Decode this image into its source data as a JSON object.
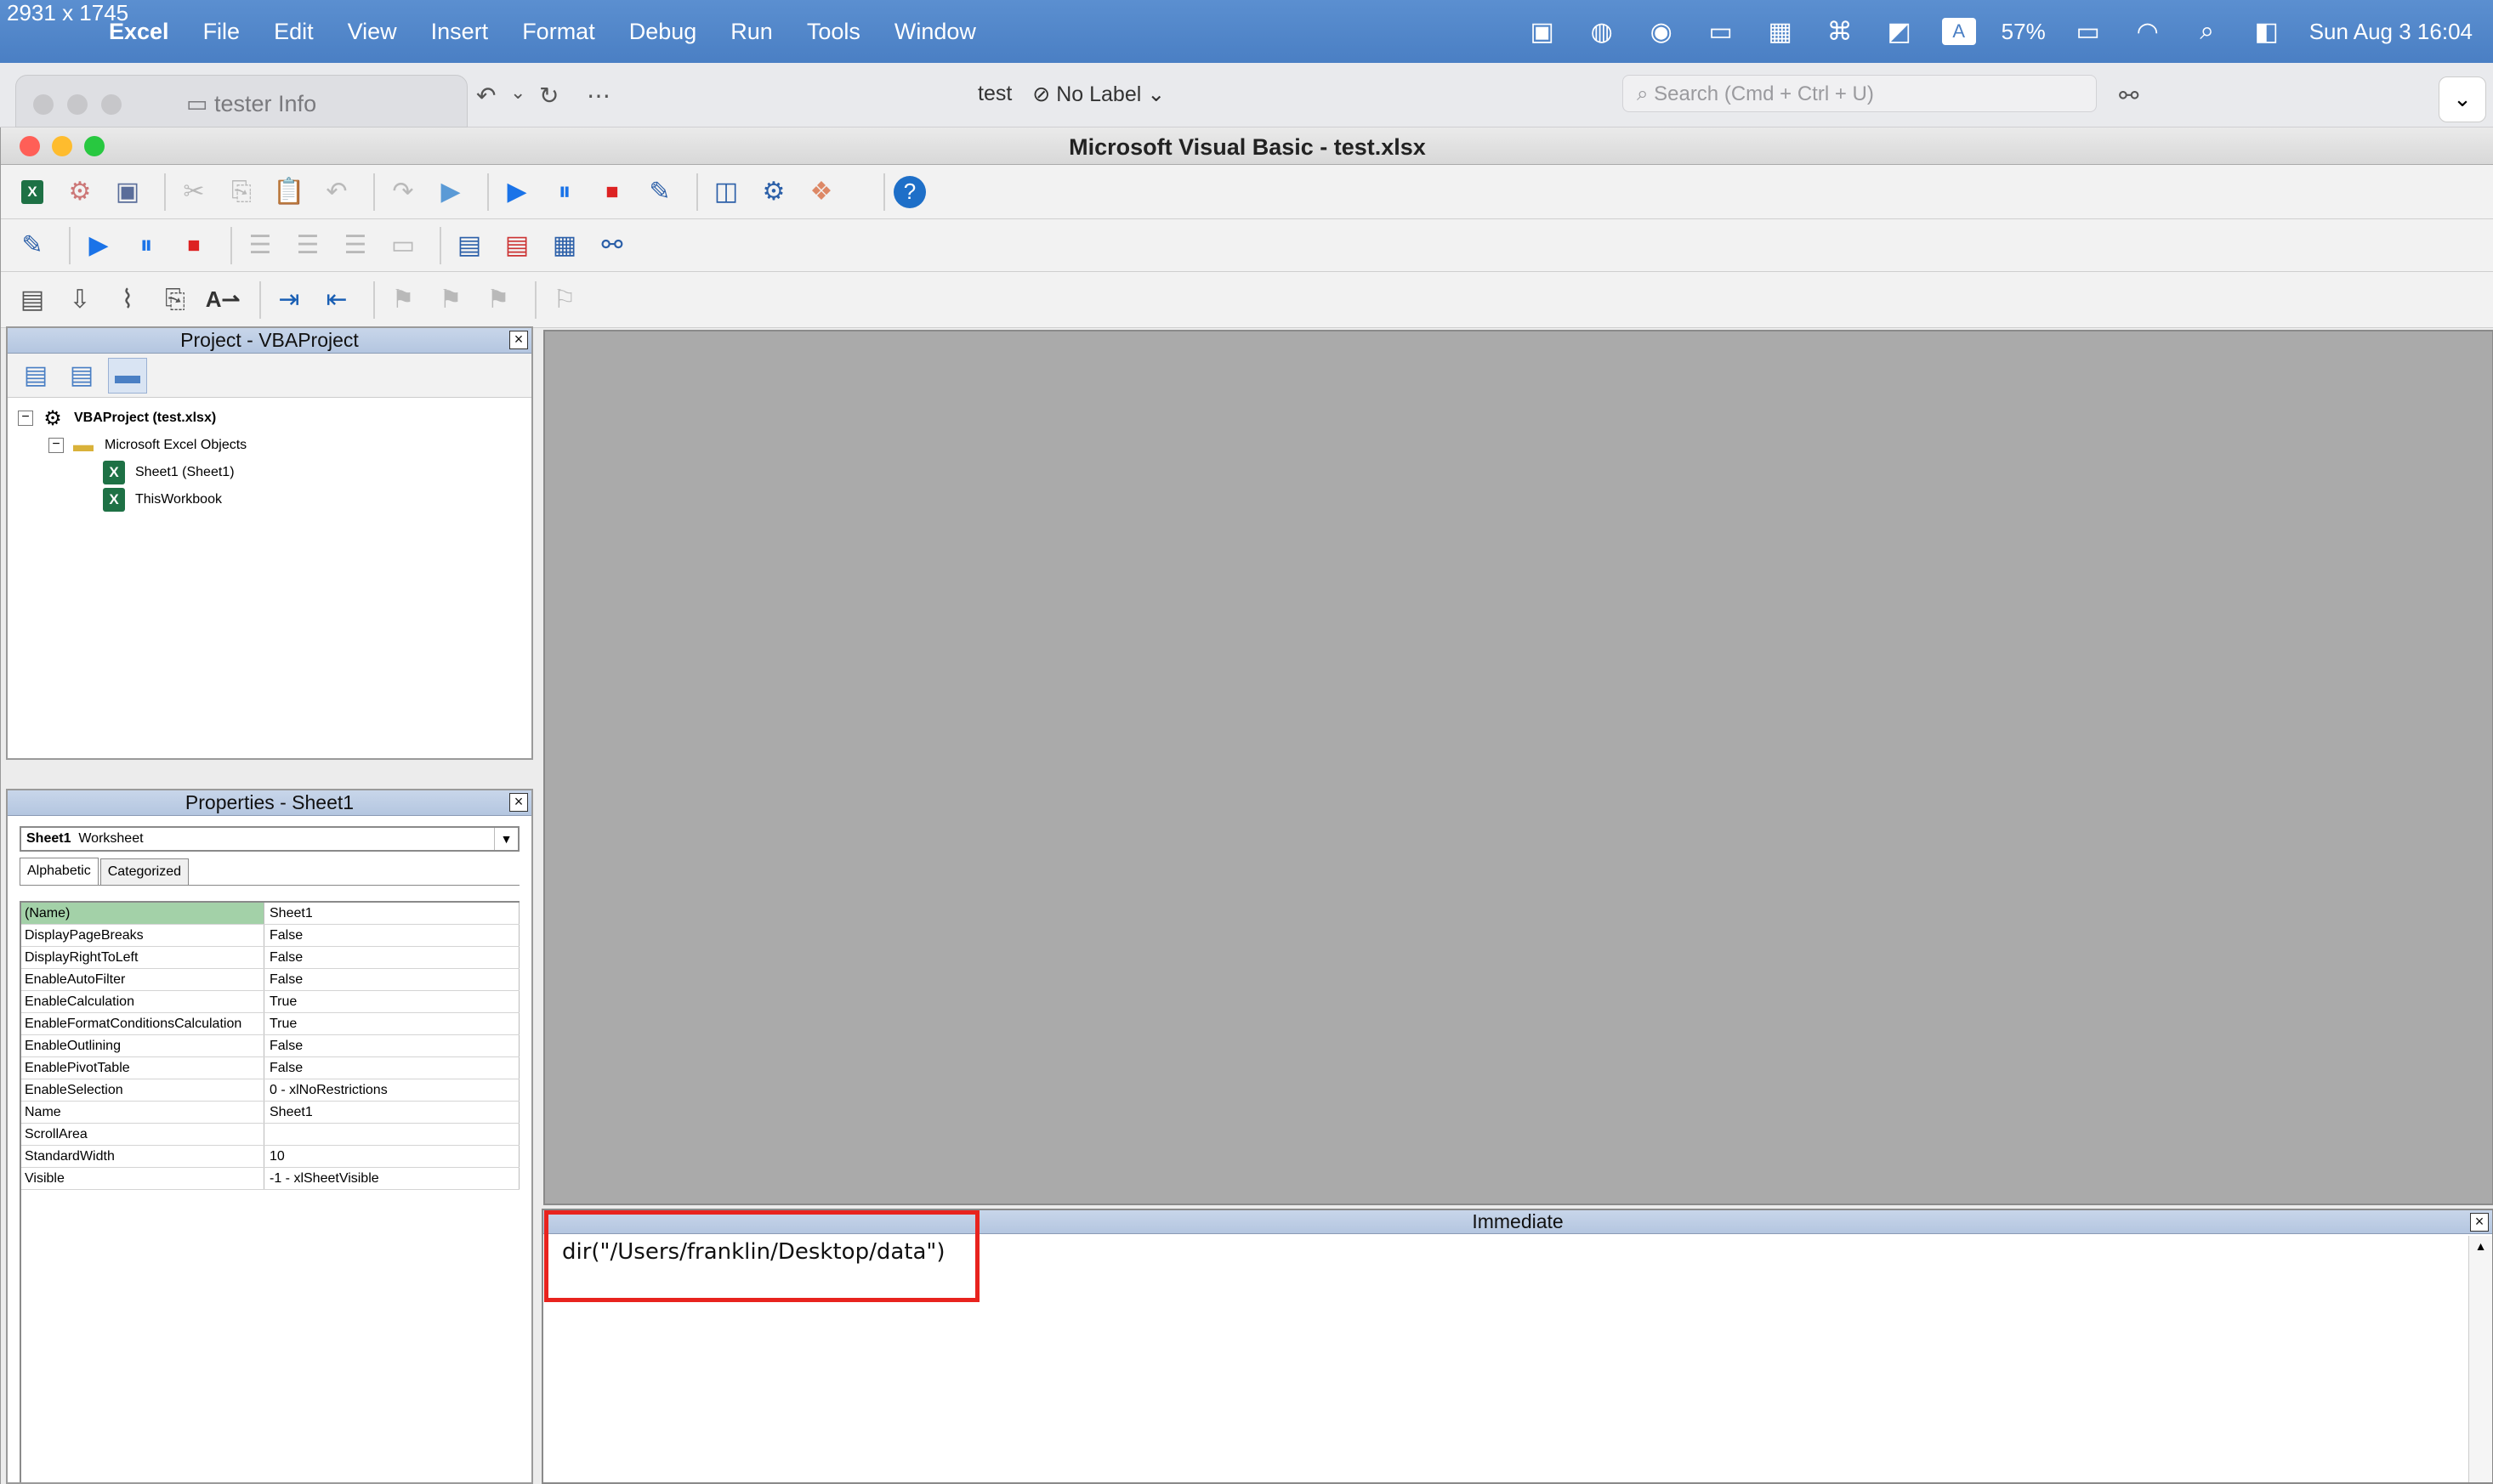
{
  "overlay_dims": "2931 x 1745",
  "menubar": {
    "app": "Excel",
    "items": [
      "File",
      "Edit",
      "View",
      "Insert",
      "Format",
      "Debug",
      "Run",
      "Tools",
      "Window"
    ],
    "input_source": "A",
    "battery": "57%",
    "clock": "Sun Aug 3  16:04"
  },
  "excel_window": {
    "tab_title": "tester Info",
    "doc_name": "test",
    "label": "No Label",
    "search_placeholder": "Search (Cmd + Ctrl + U)"
  },
  "vbe": {
    "title": "Microsoft Visual Basic - test.xlsx"
  },
  "project": {
    "title": "Project - VBAProject",
    "tree": [
      {
        "label": "VBAProject (test.xlsx)",
        "level": 0,
        "icon": "vba-project-icon"
      },
      {
        "label": "Microsoft Excel Objects",
        "level": 1,
        "icon": "folder-icon"
      },
      {
        "label": "Sheet1 (Sheet1)",
        "level": 2,
        "icon": "excel-sheet-icon"
      },
      {
        "label": "ThisWorkbook",
        "level": 2,
        "icon": "excel-sheet-icon"
      }
    ]
  },
  "properties": {
    "title": "Properties - Sheet1",
    "object_name": "Sheet1",
    "object_type": "Worksheet",
    "tabs": [
      "Alphabetic",
      "Categorized"
    ],
    "rows": [
      {
        "k": "(Name)",
        "v": "Sheet1"
      },
      {
        "k": "DisplayPageBreaks",
        "v": "False"
      },
      {
        "k": "DisplayRightToLeft",
        "v": "False"
      },
      {
        "k": "EnableAutoFilter",
        "v": "False"
      },
      {
        "k": "EnableCalculation",
        "v": "True"
      },
      {
        "k": "EnableFormatConditionsCalculation",
        "v": "True"
      },
      {
        "k": "EnableOutlining",
        "v": "False"
      },
      {
        "k": "EnablePivotTable",
        "v": "False"
      },
      {
        "k": "EnableSelection",
        "v": "0 - xlNoRestrictions"
      },
      {
        "k": "Name",
        "v": "Sheet1"
      },
      {
        "k": "ScrollArea",
        "v": ""
      },
      {
        "k": "StandardWidth",
        "v": "10"
      },
      {
        "k": "Visible",
        "v": "-1 - xlSheetVisible"
      }
    ]
  },
  "immediate": {
    "title": "Immediate",
    "code": "dir(\"/Users/franklin/Desktop/data\")"
  },
  "colors": {
    "menubar": "#4a7fc4",
    "highlight": "#e8231e",
    "mdi": "#aaaaaa",
    "selected_prop": "#a3d1a8"
  }
}
